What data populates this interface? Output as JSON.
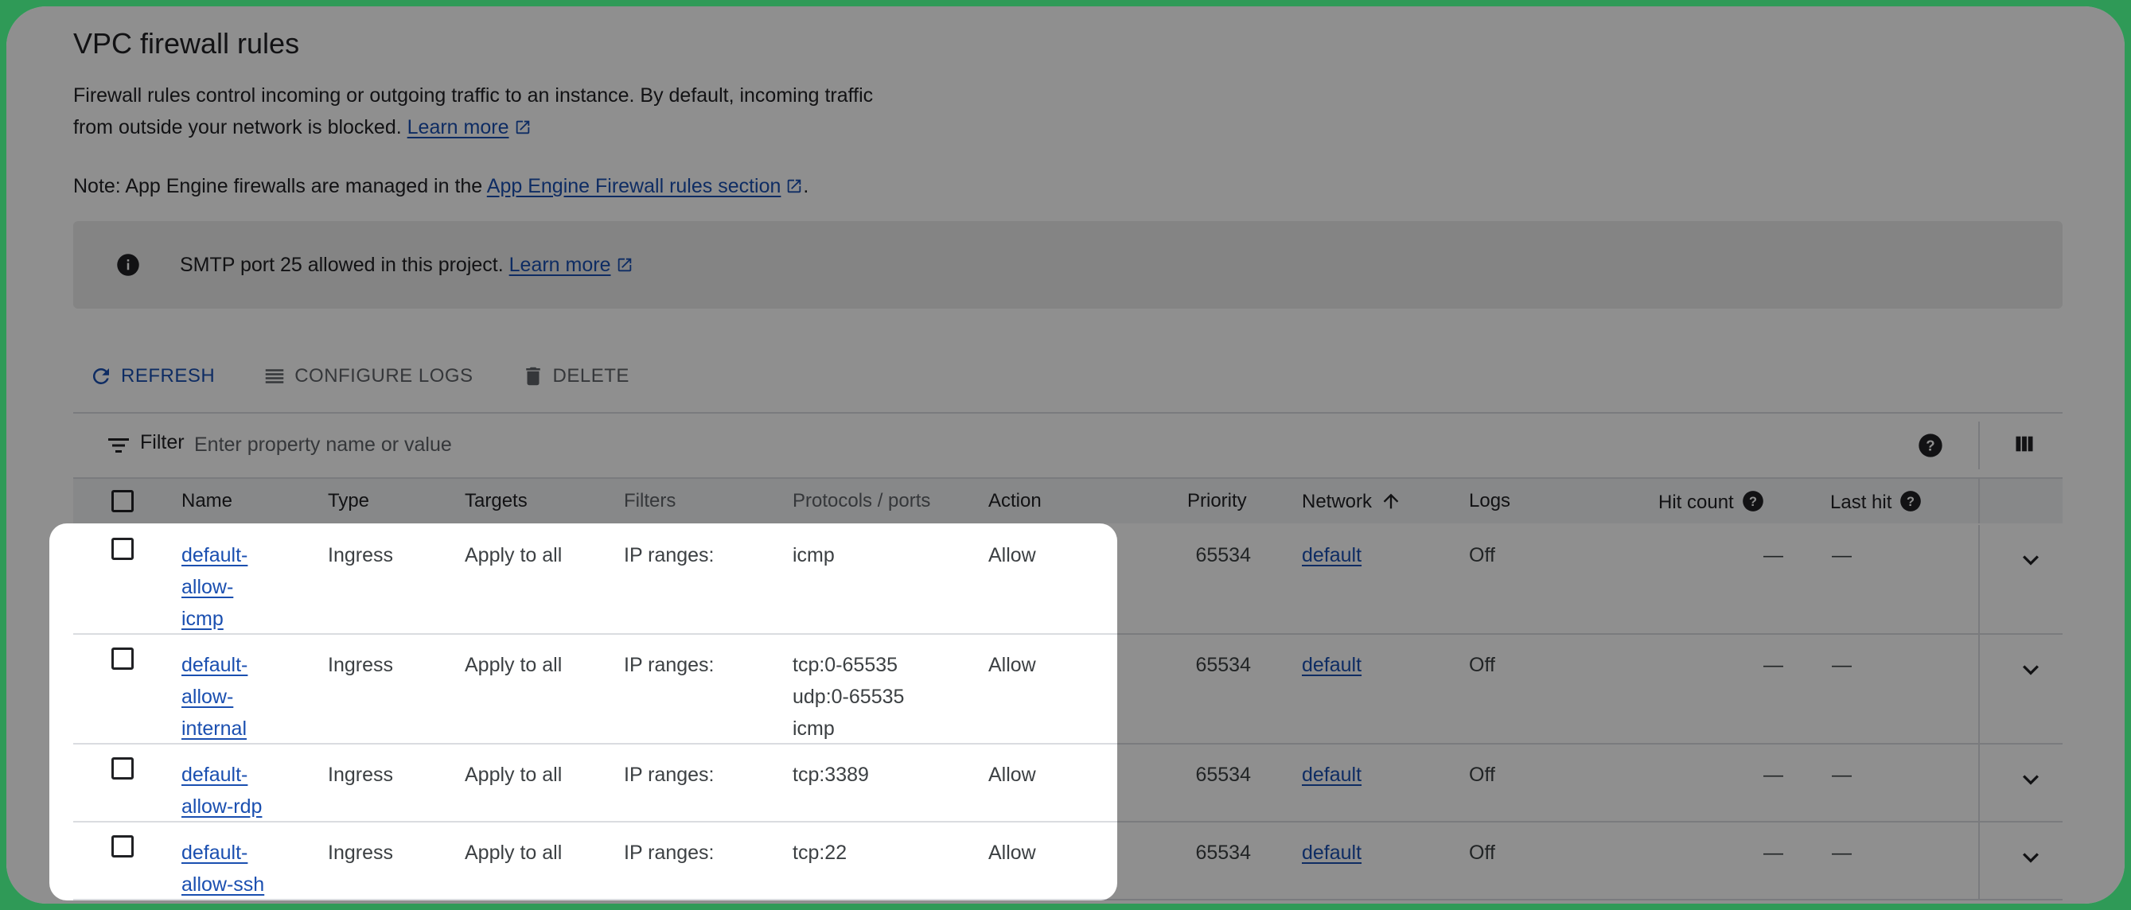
{
  "page": {
    "title": "VPC firewall rules",
    "description": "Firewall rules control incoming or outgoing traffic to an instance. By default, incoming traffic from outside your network is blocked.",
    "learn_more": "Learn more",
    "note_prefix": "Note: App Engine firewalls are managed in the ",
    "note_link": "App Engine Firewall rules section",
    "note_suffix": "."
  },
  "banner": {
    "icon": "info-icon",
    "text": "SMTP port 25 allowed in this project.",
    "link": "Learn more"
  },
  "toolbar": {
    "refresh": "REFRESH",
    "configure_logs": "CONFIGURE LOGS",
    "delete": "DELETE"
  },
  "filter": {
    "label": "Filter",
    "placeholder": "Enter property name or value"
  },
  "table": {
    "columns": {
      "name": "Name",
      "type": "Type",
      "targets": "Targets",
      "filters": "Filters",
      "protocols": "Protocols / ports",
      "action": "Action",
      "priority": "Priority",
      "network": "Network",
      "logs": "Logs",
      "hit_count": "Hit count",
      "last_hit": "Last hit"
    },
    "sort": {
      "column": "Network",
      "direction": "ascending"
    },
    "rows": [
      {
        "name_lines": [
          "default-",
          "allow-",
          "icmp"
        ],
        "type": "Ingress",
        "targets": "Apply to all",
        "filters": "IP ranges:",
        "protocols": [
          "icmp"
        ],
        "action": "Allow",
        "priority": "65534",
        "network": "default",
        "logs": "Off",
        "hit_count": "—",
        "last_hit": "—"
      },
      {
        "name_lines": [
          "default-",
          "allow-",
          "internal"
        ],
        "type": "Ingress",
        "targets": "Apply to all",
        "filters": "IP ranges:",
        "protocols": [
          "tcp:0-65535",
          "udp:0-65535",
          "icmp"
        ],
        "action": "Allow",
        "priority": "65534",
        "network": "default",
        "logs": "Off",
        "hit_count": "—",
        "last_hit": "—"
      },
      {
        "name_lines": [
          "default-",
          "allow-rdp"
        ],
        "type": "Ingress",
        "targets": "Apply to all",
        "filters": "IP ranges:",
        "protocols": [
          "tcp:3389"
        ],
        "action": "Allow",
        "priority": "65534",
        "network": "default",
        "logs": "Off",
        "hit_count": "—",
        "last_hit": "—"
      },
      {
        "name_lines": [
          "default-",
          "allow-ssh"
        ],
        "type": "Ingress",
        "targets": "Apply to all",
        "filters": "IP ranges:",
        "protocols": [
          "tcp:22"
        ],
        "action": "Allow",
        "priority": "65534",
        "network": "default",
        "logs": "Off",
        "hit_count": "—",
        "last_hit": "—"
      }
    ]
  },
  "colors": {
    "frame": "#2f9a57",
    "link": "#1a4fb0",
    "dim_overlay": "rgba(0,0,0,0.44)"
  }
}
